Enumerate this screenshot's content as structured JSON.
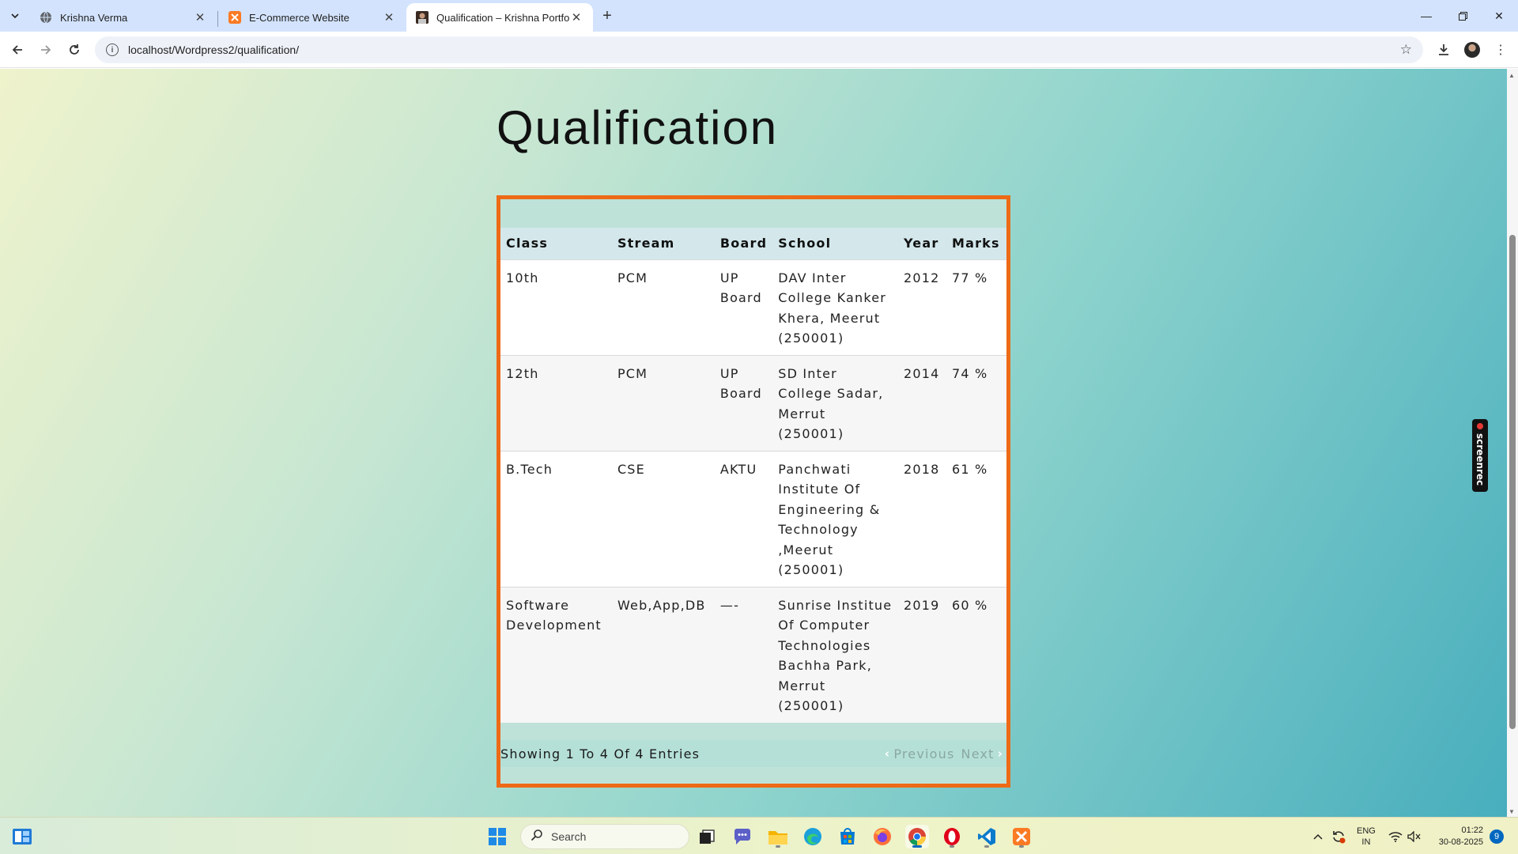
{
  "browser": {
    "tabs": [
      {
        "title": "Krishna Verma",
        "active": false
      },
      {
        "title": "E-Commerce Website",
        "active": false
      },
      {
        "title": "Qualification – Krishna Portfolio",
        "active": true
      }
    ],
    "url": "localhost/Wordpress2/qualification/"
  },
  "page": {
    "heading": "Qualification",
    "table": {
      "headers": [
        "Class",
        "Stream",
        "Board",
        "School",
        "Year",
        "Marks"
      ],
      "rows": [
        {
          "class": "10th",
          "stream": "PCM",
          "board": "UP Board",
          "school": "DAV Inter College Kanker Khera, Meerut (250001)",
          "year": "2012",
          "marks": "77 %"
        },
        {
          "class": "12th",
          "stream": "PCM",
          "board": "UP Board",
          "school": "SD Inter College Sadar, Merrut (250001)",
          "year": "2014",
          "marks": "74 %"
        },
        {
          "class": "B.Tech",
          "stream": "CSE",
          "board": "AKTU",
          "school": "Panchwati Institute Of Engineering & Technology ,Meerut (250001)",
          "year": "2018",
          "marks": "61 %"
        },
        {
          "class": "Software Development",
          "stream": "Web,App,DB",
          "board": "—-",
          "school": "Sunrise Institue Of Computer Technologies Bachha Park, Merrut (250001)",
          "year": "2019",
          "marks": "60 %"
        }
      ],
      "info": "Showing 1 To 4 Of 4 Entries",
      "prev_label": "Previous",
      "next_label": "Next"
    },
    "recorder_badge": "screenrec"
  },
  "taskbar": {
    "search_placeholder": "Search",
    "lang_top": "ENG",
    "lang_bottom": "IN",
    "time": "01:22",
    "date": "30-08-2025",
    "notification_count": "9"
  },
  "colors": {
    "table_border": "#ed6a16",
    "header_bg": "#d4e8ec",
    "tabstrip": "#d3e3fd"
  }
}
